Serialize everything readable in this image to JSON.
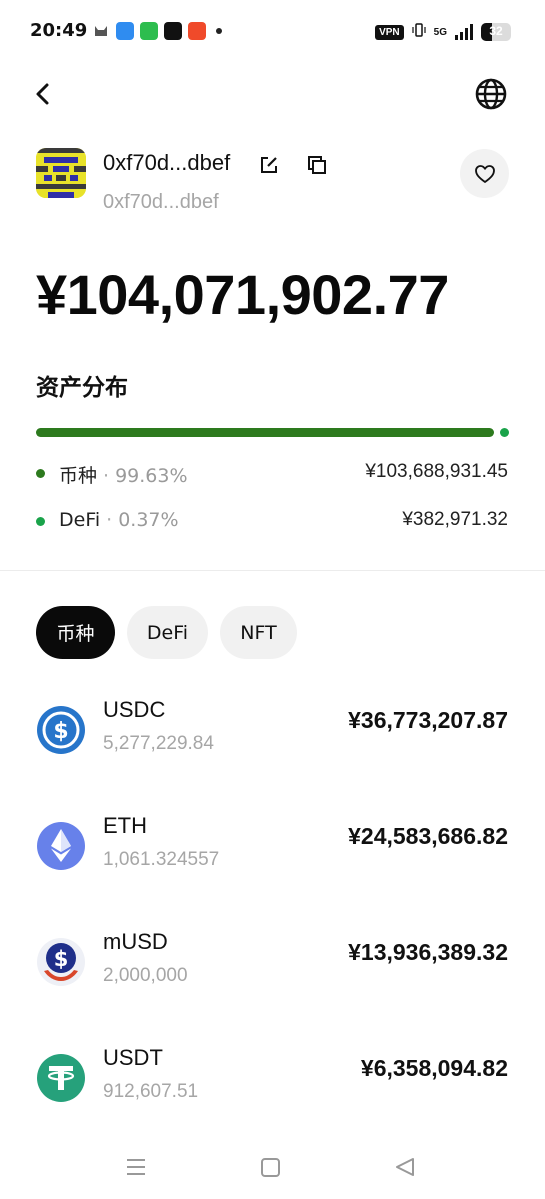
{
  "status_bar": {
    "time": "20:49",
    "vpn_label": "VPN",
    "network_label": "5G",
    "battery_level": "32"
  },
  "wallet": {
    "name": "0xf70d...dbef",
    "address": "0xf70d...dbef",
    "total_value": "¥104,071,902.77"
  },
  "distribution": {
    "title": "资产分布",
    "items": [
      {
        "label": "币种",
        "percent": "99.63%",
        "value": "¥103,688,931.45",
        "color": "#2d7a1e"
      },
      {
        "label": "DeFi",
        "percent": "0.37%",
        "value": "¥382,971.32",
        "color": "#1aa34a"
      }
    ]
  },
  "tabs": [
    {
      "label": "币种",
      "active": true
    },
    {
      "label": "DeFi",
      "active": false
    },
    {
      "label": "NFT",
      "active": false
    }
  ],
  "tokens": [
    {
      "symbol": "USDC",
      "amount": "5,277,229.84",
      "fiat": "¥36,773,207.87",
      "icon": "usdc-icon"
    },
    {
      "symbol": "ETH",
      "amount": "1,061.324557",
      "fiat": "¥24,583,686.82",
      "icon": "eth-icon"
    },
    {
      "symbol": "mUSD",
      "amount": "2,000,000",
      "fiat": "¥13,936,389.32",
      "icon": "musd-icon"
    },
    {
      "symbol": "USDT",
      "amount": "912,607.51",
      "fiat": "¥6,358,094.82",
      "icon": "usdt-icon"
    }
  ]
}
